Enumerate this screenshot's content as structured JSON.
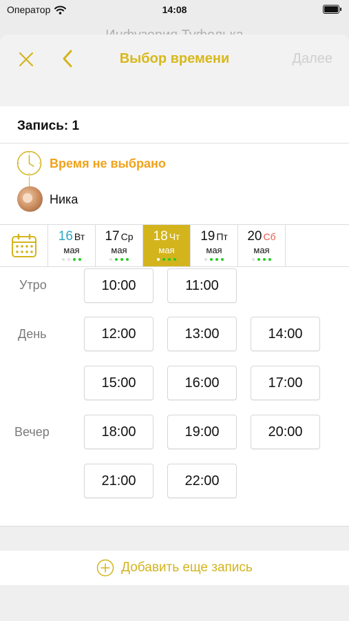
{
  "status_bar": {
    "carrier": "Оператор",
    "time": "14:08"
  },
  "background_title": "Инфузория Туфелька",
  "nav": {
    "title": "Выбор времени",
    "next_label": "Далее"
  },
  "booking": {
    "header": "Запись: 1",
    "time_status": "Время не выбрано",
    "master_name": "Ника"
  },
  "dates": [
    {
      "day": "16",
      "dow": "Вт",
      "month": "мая",
      "selected": false,
      "day_color": "#2ba6c9",
      "dow_color": "#111111",
      "dots": [
        "#e0e0e0",
        "#e0e0e0",
        "#22cc22",
        "#22cc22"
      ]
    },
    {
      "day": "17",
      "dow": "Ср",
      "month": "мая",
      "selected": false,
      "day_color": "#111111",
      "dow_color": "#111111",
      "dots": [
        "#e0e0e0",
        "#22cc22",
        "#22cc22",
        "#22cc22"
      ]
    },
    {
      "day": "18",
      "dow": "Чт",
      "month": "мая",
      "selected": true,
      "day_color": "#ffffff",
      "dow_color": "#ffffff",
      "dots": [
        "#ffffff",
        "#22cc22",
        "#22cc22",
        "#22cc22"
      ]
    },
    {
      "day": "19",
      "dow": "Пт",
      "month": "мая",
      "selected": false,
      "day_color": "#111111",
      "dow_color": "#111111",
      "dots": [
        "#e0e0e0",
        "#22cc22",
        "#22cc22",
        "#22cc22"
      ]
    },
    {
      "day": "20",
      "dow": "Сб",
      "month": "мая",
      "selected": false,
      "day_color": "#111111",
      "dow_color": "#e8584a",
      "dots": [
        "#e0e0e0",
        "#22cc22",
        "#22cc22",
        "#22cc22"
      ]
    }
  ],
  "periods": {
    "morning": "Утро",
    "day": "День",
    "evening": "Вечер"
  },
  "slots": {
    "morning": [
      "10:00",
      "11:00"
    ],
    "day": [
      "12:00",
      "13:00",
      "14:00",
      "15:00",
      "16:00",
      "17:00"
    ],
    "evening": [
      "18:00",
      "19:00",
      "20:00",
      "21:00",
      "22:00"
    ]
  },
  "add_booking_label": "Добавить еще запись",
  "colors": {
    "accent": "#d3b41d",
    "warning": "#f0a21b",
    "available": "#22cc22"
  },
  "icons": {
    "close": "close-icon",
    "back": "chevron-left-icon",
    "calendar": "calendar-icon",
    "clock": "clock-icon",
    "add": "plus-circle-icon"
  }
}
